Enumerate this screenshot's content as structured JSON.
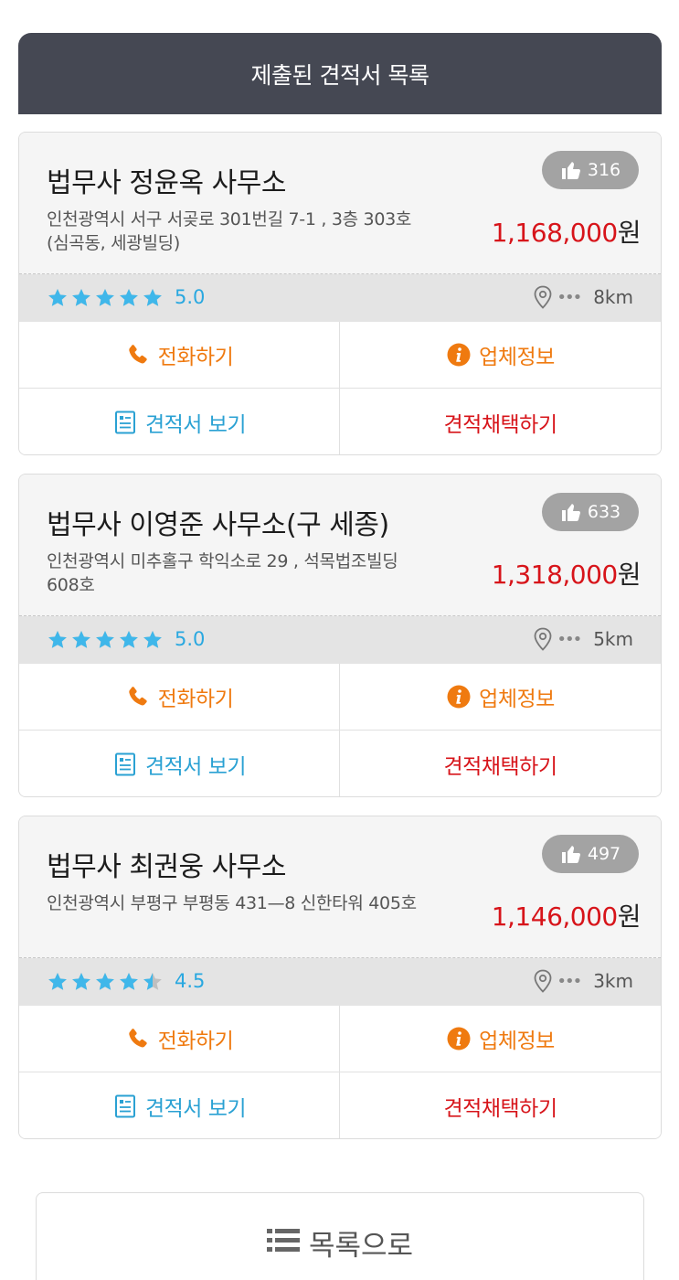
{
  "header": {
    "title": "제출된 견적서 목록"
  },
  "cards": [
    {
      "name": "법무사 정윤옥 사무소",
      "likes": "316",
      "address": "인천광역시 서구 서곶로 301번길 7-1 , 3층 303호(심곡동, 세광빌딩)",
      "price": "1,168,000",
      "price_unit": "원",
      "rating": 5.0,
      "score": "5.0",
      "distance": "8km",
      "buttons": {
        "call": "전화하기",
        "info": "업체정보",
        "view": "견적서 보기",
        "select": "견적채택하기"
      }
    },
    {
      "name": "법무사 이영준 사무소(구 세종)",
      "likes": "633",
      "address": "인천광역시 미추홀구 학익소로 29 , 석목법조빌딩 608호",
      "price": "1,318,000",
      "price_unit": "원",
      "rating": 5.0,
      "score": "5.0",
      "distance": "5km",
      "buttons": {
        "call": "전화하기",
        "info": "업체정보",
        "view": "견적서 보기",
        "select": "견적채택하기"
      }
    },
    {
      "name": "법무사 최권웅 사무소",
      "likes": "497",
      "address": "인천광역시 부평구 부평동 431—8 신한타워 405호",
      "price": "1,146,000",
      "price_unit": "원",
      "rating": 4.5,
      "score": "4.5",
      "distance": "3km",
      "buttons": {
        "call": "전화하기",
        "info": "업체정보",
        "view": "견적서 보기",
        "select": "견적채택하기"
      }
    }
  ],
  "footer": {
    "list_label": "목록으로"
  },
  "colors": {
    "header_bg": "#454853",
    "price_red": "#d7141a",
    "star_blue": "#3fb7ea",
    "call_orange": "#ef7a10",
    "view_blue": "#2aa1d3",
    "likes_gray": "#a3a3a3"
  },
  "icons": {
    "like": "thumbs-up-icon",
    "location": "map-pin-icon",
    "call": "phone-icon",
    "info": "info-icon",
    "view": "document-icon",
    "list": "list-icon"
  }
}
